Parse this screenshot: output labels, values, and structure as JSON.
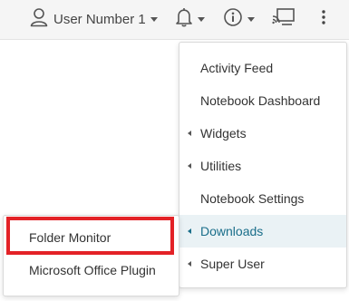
{
  "topbar": {
    "user_label": "User Number 1"
  },
  "icons": {
    "user": "user-icon",
    "bell": "bell-icon",
    "info": "info-icon",
    "cast": "screen-share-icon",
    "more": "more-vertical-icon"
  },
  "main_menu": {
    "items": [
      {
        "label": "Activity Feed",
        "submenu": false
      },
      {
        "label": "Notebook Dashboard",
        "submenu": false
      },
      {
        "label": "Widgets",
        "submenu": true
      },
      {
        "label": "Utilities",
        "submenu": true
      },
      {
        "label": "Notebook Settings",
        "submenu": false
      },
      {
        "label": "Downloads",
        "submenu": true,
        "active": true
      },
      {
        "label": "Super User",
        "submenu": true
      }
    ]
  },
  "downloads_submenu": {
    "items": [
      {
        "label": "Folder Monitor"
      },
      {
        "label": "Microsoft Office Plugin"
      }
    ]
  },
  "colors": {
    "highlight_border": "#e32227",
    "active_text": "#1a6e8a",
    "active_background": "#eaf2f5"
  }
}
